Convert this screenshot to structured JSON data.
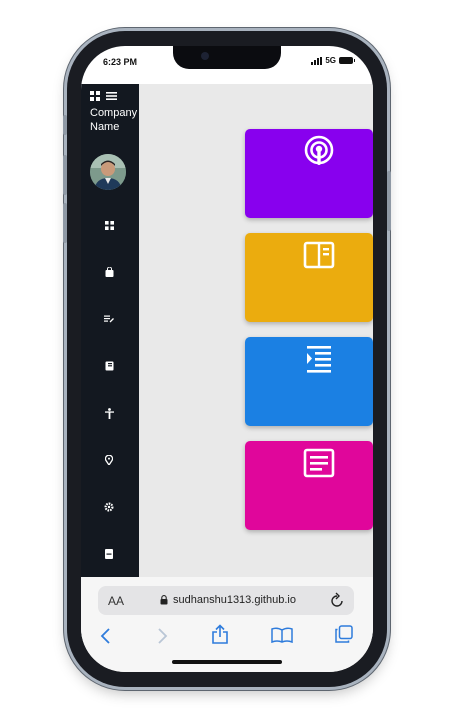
{
  "status_bar": {
    "time": "6:23 PM",
    "network": "5G"
  },
  "sidebar": {
    "company_name": "Company Name",
    "nav_items": [
      "dashboard-icon",
      "shopping-bag-icon",
      "edit-list-icon",
      "book-icon",
      "person-icon",
      "location-pin-icon",
      "settings-icon",
      "document-icon"
    ]
  },
  "cards": [
    {
      "icon": "podcast-icon",
      "color": "#8800ee"
    },
    {
      "icon": "dashboard-panel-icon",
      "color": "#ebac0e"
    },
    {
      "icon": "indent-list-icon",
      "color": "#1b80e3"
    },
    {
      "icon": "article-icon",
      "color": "#e0069b"
    }
  ],
  "safari": {
    "aa_label": "AA",
    "url": "sudhanshu1313.github.io"
  }
}
